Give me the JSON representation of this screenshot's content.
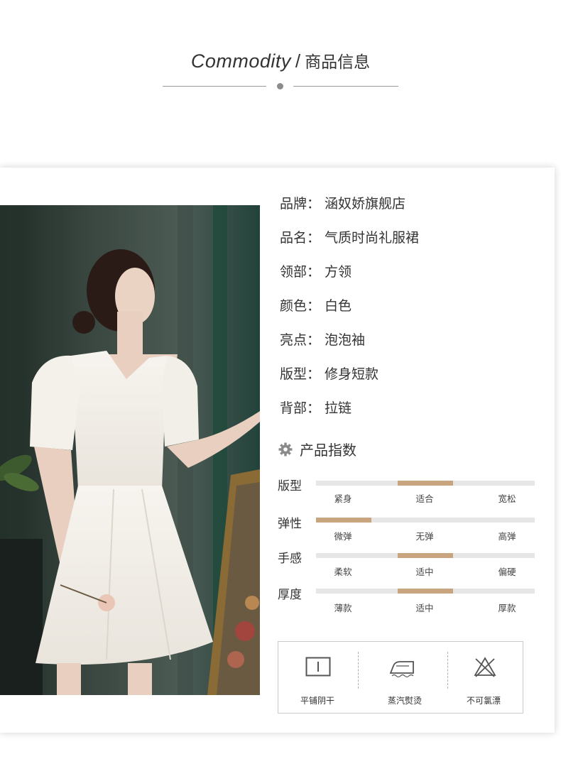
{
  "header": {
    "title_en": "Commodity",
    "separator": "/",
    "title_cn": "商品信息"
  },
  "product": {
    "attributes": [
      {
        "label": "品牌：",
        "value": "涵奴娇旗舰店"
      },
      {
        "label": "品名：",
        "value": "气质时尚礼服裙"
      },
      {
        "label": "领部：",
        "value": "方领"
      },
      {
        "label": "颜色：",
        "value": "白色"
      },
      {
        "label": "亮点：",
        "value": "泡泡袖"
      },
      {
        "label": "版型：",
        "value": "修身短款"
      },
      {
        "label": "背部：",
        "value": "拉链"
      }
    ]
  },
  "index_section": {
    "title": "产品指数",
    "icon": "gear-icon",
    "accent_color": "#c8a57e",
    "track_color": "#e6e6e6",
    "metrics": [
      {
        "label": "版型",
        "options": [
          "紧身",
          "适合",
          "宽松"
        ],
        "selected_index": 1
      },
      {
        "label": "弹性",
        "options": [
          "微弹",
          "无弹",
          "高弹"
        ],
        "selected_index": 0
      },
      {
        "label": "手感",
        "options": [
          "柔软",
          "适中",
          "偏硬"
        ],
        "selected_index": 1
      },
      {
        "label": "厚度",
        "options": [
          "薄款",
          "适中",
          "厚款"
        ],
        "selected_index": 1
      }
    ]
  },
  "care": [
    {
      "icon": "flat-dry-icon",
      "label": "平铺阴干"
    },
    {
      "icon": "steam-iron-icon",
      "label": "蒸汽熨烫"
    },
    {
      "icon": "no-bleach-icon",
      "label": "不可氯漂"
    }
  ]
}
